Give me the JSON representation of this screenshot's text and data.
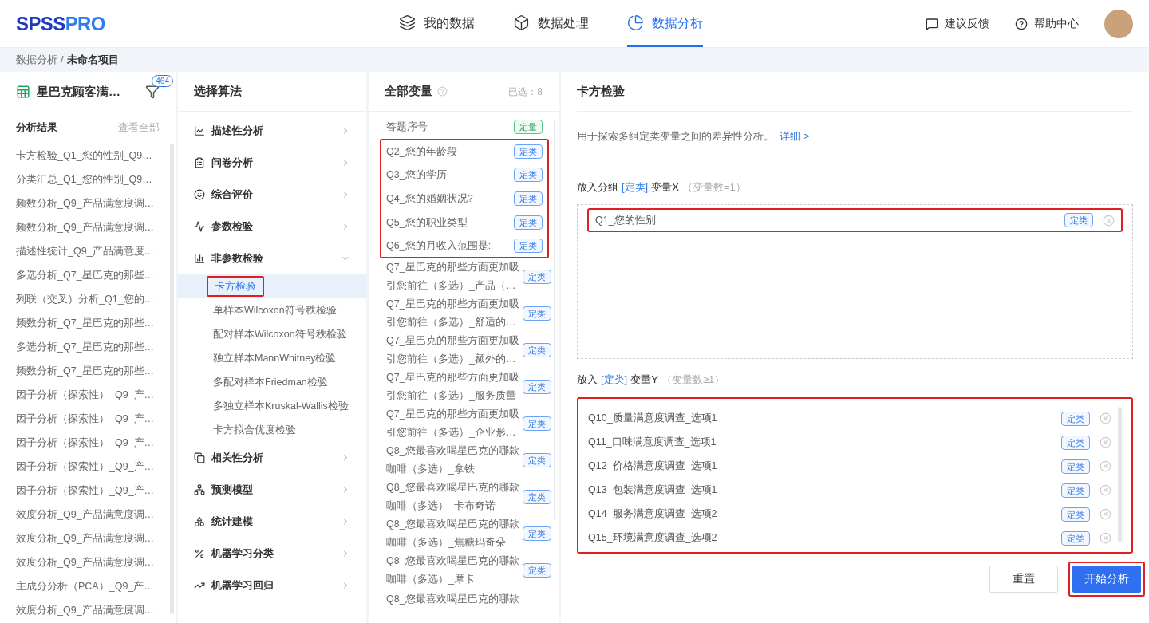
{
  "logo": {
    "part1": "SPSS",
    "part2": "PRO"
  },
  "nav": [
    {
      "label": "我的数据",
      "selected": false
    },
    {
      "label": "数据处理",
      "selected": false
    },
    {
      "label": "数据分析",
      "selected": true
    }
  ],
  "header_actions": [
    "建议反馈",
    "帮助中心"
  ],
  "breadcrumb": {
    "parent": "数据分析",
    "separator": "/",
    "current": "未命名项目"
  },
  "dataset": {
    "name": "星巴克顾客满…",
    "badge": "464"
  },
  "results": {
    "title": "分析结果",
    "view_all": "查看全部",
    "items": [
      "卡方检验_Q1_您的性别_Q9…",
      "分类汇总_Q1_您的性别_Q9…",
      "频数分析_Q9_产品满意度调…",
      "频数分析_Q9_产品满意度调…",
      "描述性统计_Q9_产品满意度…",
      "多选分析_Q7_星巴克的那些…",
      "列联（交叉）分析_Q1_您的…",
      "频数分析_Q7_星巴克的那些…",
      "多选分析_Q7_星巴克的那些…",
      "频数分析_Q7_星巴克的那些…",
      "因子分析（探索性）_Q9_产…",
      "因子分析（探索性）_Q9_产…",
      "因子分析（探索性）_Q9_产…",
      "因子分析（探索性）_Q9_产…",
      "因子分析（探索性）_Q9_产…",
      "效度分析_Q9_产品满意度调…",
      "效度分析_Q9_产品满意度调…",
      "效度分析_Q9_产品满意度调…",
      "主成分分析（PCA）_Q9_产…",
      "效度分析_Q9_产品满意度调…"
    ]
  },
  "algorithms": {
    "title": "选择算法",
    "categories": [
      {
        "label": "描述性分析",
        "expanded": false
      },
      {
        "label": "问卷分析",
        "expanded": false
      },
      {
        "label": "综合评价",
        "expanded": false
      },
      {
        "label": "参数检验",
        "expanded": false
      },
      {
        "label": "非参数检验",
        "expanded": true,
        "children": [
          {
            "label": "卡方检验",
            "selected": true,
            "highlighted": true
          },
          {
            "label": "单样本Wilcoxon符号秩检验",
            "selected": false,
            "highlighted": false
          },
          {
            "label": "配对样本Wilcoxon符号秩检验",
            "selected": false,
            "highlighted": false
          },
          {
            "label": "独立样本MannWhitney检验",
            "selected": false,
            "highlighted": false
          },
          {
            "label": "多配对样本Friedman检验",
            "selected": false,
            "highlighted": false
          },
          {
            "label": "多独立样本Kruskal-Wallis检验",
            "selected": false,
            "highlighted": false
          },
          {
            "label": "卡方拟合优度检验",
            "selected": false,
            "highlighted": false
          }
        ]
      },
      {
        "label": "相关性分析",
        "expanded": false
      },
      {
        "label": "预测模型",
        "expanded": false
      },
      {
        "label": "统计建模",
        "expanded": false
      },
      {
        "label": "机器学习分类",
        "expanded": false
      },
      {
        "label": "机器学习回归",
        "expanded": false
      }
    ]
  },
  "variables": {
    "title": "全部变量",
    "selected_count": "已选：8",
    "items": [
      {
        "lines": [
          "答题序号"
        ],
        "tag": "定量",
        "kind": "quantitative",
        "highlighted": false
      },
      {
        "lines": [
          "Q2_您的年龄段"
        ],
        "tag": "定类",
        "kind": "categorical",
        "highlighted": true
      },
      {
        "lines": [
          "Q3_您的学历"
        ],
        "tag": "定类",
        "kind": "categorical",
        "highlighted": true
      },
      {
        "lines": [
          "Q4_您的婚姻状况?"
        ],
        "tag": "定类",
        "kind": "categorical",
        "highlighted": true
      },
      {
        "lines": [
          "Q5_您的职业类型"
        ],
        "tag": "定类",
        "kind": "categorical",
        "highlighted": true
      },
      {
        "lines": [
          "Q6_您的月收入范围是:"
        ],
        "tag": "定类",
        "kind": "categorical",
        "highlighted": true
      },
      {
        "lines": [
          "Q7_星巴克的那些方面更加吸",
          "引您前往（多选）_产品（…"
        ],
        "tag": "定类",
        "kind": "categorical",
        "highlighted": false
      },
      {
        "lines": [
          "Q7_星巴克的那些方面更加吸",
          "引您前往（多选）_舒适的…"
        ],
        "tag": "定类",
        "kind": "categorical",
        "highlighted": false
      },
      {
        "lines": [
          "Q7_星巴克的那些方面更加吸",
          "引您前往（多选）_额外的…"
        ],
        "tag": "定类",
        "kind": "categorical",
        "highlighted": false
      },
      {
        "lines": [
          "Q7_星巴克的那些方面更加吸",
          "引您前往（多选）_服务质量"
        ],
        "tag": "定类",
        "kind": "categorical",
        "highlighted": false
      },
      {
        "lines": [
          "Q7_星巴克的那些方面更加吸",
          "引您前往（多选）_企业形…"
        ],
        "tag": "定类",
        "kind": "categorical",
        "highlighted": false
      },
      {
        "lines": [
          "Q8_您最喜欢喝星巴克的哪款",
          "咖啡（多选）_拿铁"
        ],
        "tag": "定类",
        "kind": "categorical",
        "highlighted": false
      },
      {
        "lines": [
          "Q8_您最喜欢喝星巴克的哪款",
          "咖啡（多选）_卡布奇诺"
        ],
        "tag": "定类",
        "kind": "categorical",
        "highlighted": false
      },
      {
        "lines": [
          "Q8_您最喜欢喝星巴克的哪款",
          "咖啡（多选）_焦糖玛奇朵"
        ],
        "tag": "定类",
        "kind": "categorical",
        "highlighted": false
      },
      {
        "lines": [
          "Q8_您最喜欢喝星巴克的哪款",
          "咖啡（多选）_摩卡"
        ],
        "tag": "定类",
        "kind": "categorical",
        "highlighted": false
      },
      {
        "lines": [
          "Q8_您最喜欢喝星巴克的哪款"
        ],
        "highlighted": false
      }
    ]
  },
  "config": {
    "title": "卡方检验",
    "description": "用于探索多组定类变量之间的差异性分析。",
    "detail_link": "详细 >",
    "x_label": {
      "prefix": "放入分组",
      "type": "[定类]",
      "name": "变量X",
      "hint": "（变量数=1）"
    },
    "x_items": [
      {
        "name": "Q1_您的性别",
        "tag": "定类",
        "highlighted": true
      }
    ],
    "y_label": {
      "prefix": "放入",
      "type": "[定类]",
      "name": "变量Y",
      "hint": "（变量数≥1）"
    },
    "y_highlighted": true,
    "y_items": [
      {
        "name": "Q10_质量满意度调查_选项1",
        "tag": "定类"
      },
      {
        "name": "Q11_口味满意度调查_选项1",
        "tag": "定类"
      },
      {
        "name": "Q12_价格满意度调查_选项1",
        "tag": "定类"
      },
      {
        "name": "Q13_包装满意度调查_选项1",
        "tag": "定类"
      },
      {
        "name": "Q14_服务满意度调查_选项2",
        "tag": "定类"
      },
      {
        "name": "Q15_环境满意度调查_选项2",
        "tag": "定类"
      }
    ],
    "buttons": [
      {
        "label": "重置",
        "kind": "secondary",
        "highlighted": false
      },
      {
        "label": "开始分析",
        "kind": "primary",
        "highlighted": true
      }
    ]
  }
}
